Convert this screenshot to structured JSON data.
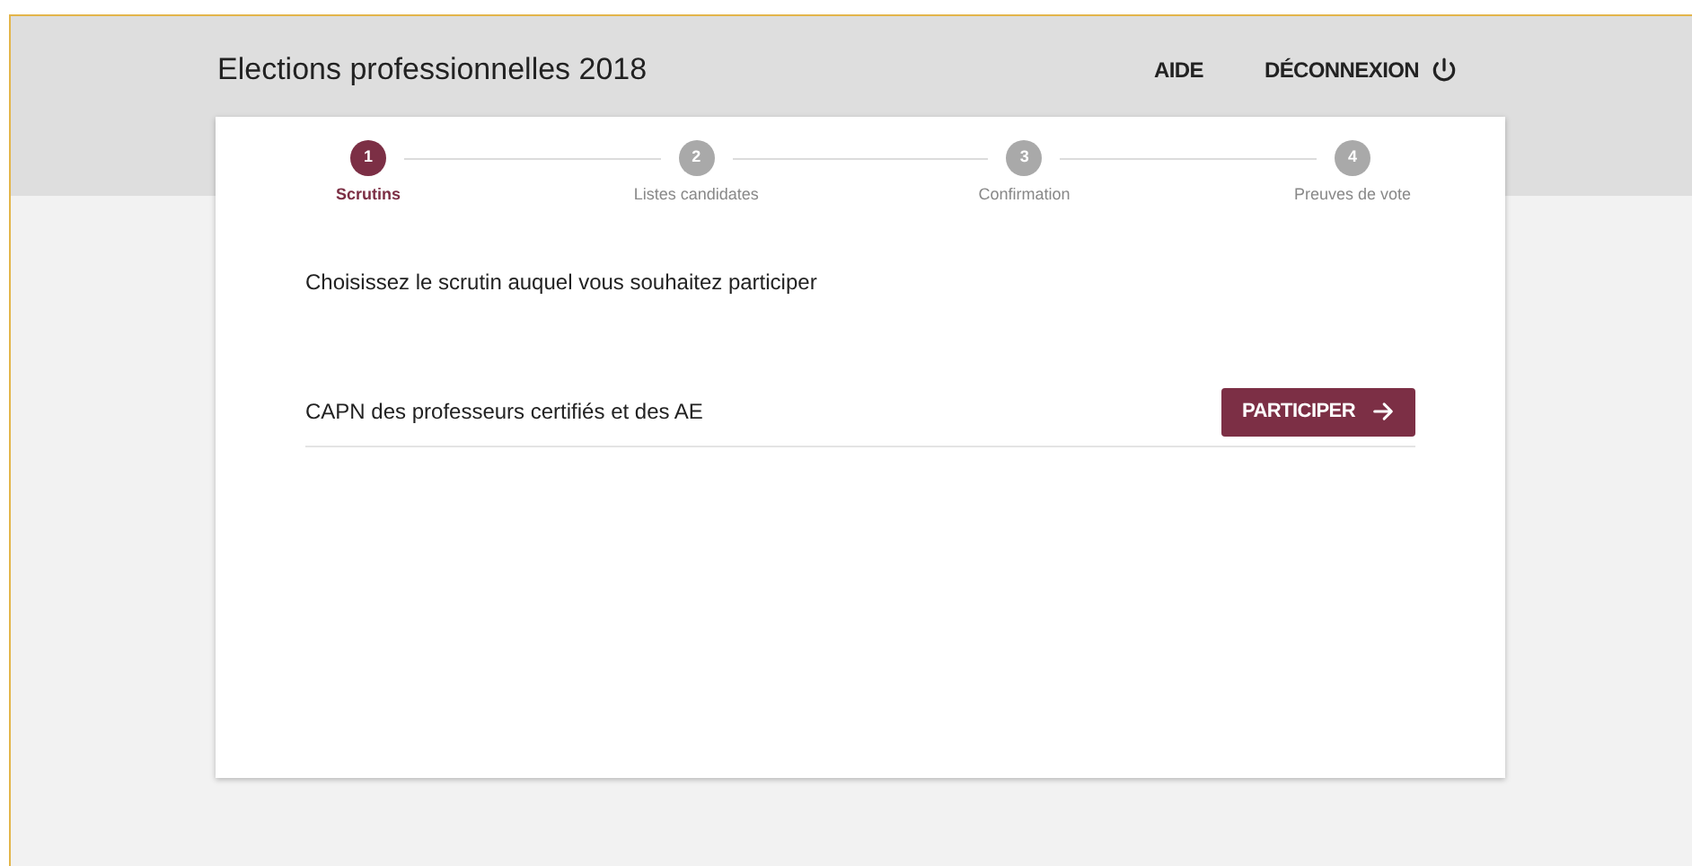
{
  "header": {
    "title": "Elections professionnelles 2018",
    "links": [
      {
        "label": "AIDE",
        "kind": "text"
      },
      {
        "label": "DÉCONNEXION",
        "kind": "power"
      }
    ]
  },
  "steps": [
    {
      "number": "1",
      "label": "Scrutins",
      "selected": true
    },
    {
      "number": "2",
      "label": "Listes candidates",
      "selected": false
    },
    {
      "number": "3",
      "label": "Confirmation",
      "selected": false
    },
    {
      "number": "4",
      "label": "Preuves de vote",
      "selected": false
    }
  ],
  "instruction": "Choisissez le scrutin auquel vous souhaitez participer",
  "ballots": [
    {
      "name": "CAPN des professeurs certifiés et des AE",
      "button": "PARTICIPER"
    }
  ]
}
